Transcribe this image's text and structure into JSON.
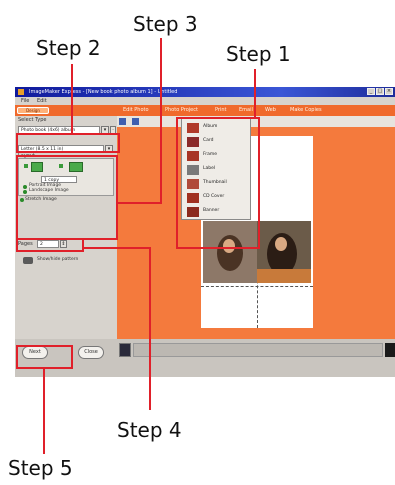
{
  "steps": {
    "step1": "Step 1",
    "step2": "Step 2",
    "step3": "Step 3",
    "step4": "Step 4",
    "step5": "Step 5"
  },
  "app": {
    "title": "ImageMaker Express - [New book photo album 1] - Untitled",
    "menu": [
      "File",
      "Edit"
    ],
    "toolbar_button": "Design",
    "toolbar_items": [
      "Edit Photo",
      "Photo Project",
      "Print",
      "Email",
      "Web",
      "Make Copies"
    ]
  },
  "left_panel": {
    "select_label": "Select Type",
    "project_select": "Photo book (4x6) album",
    "paper_select": "Letter (8.5 x 11 in)",
    "layout_label": "Layout",
    "copies_value": "1 copy",
    "options": [
      "Portrait Image",
      "Landscape Image",
      "Stretch Image"
    ],
    "pages_label": "Pages",
    "pages_value": "2",
    "canvas_option": "Show/hide pattern"
  },
  "insert_menu": {
    "items": [
      "Album",
      "Card",
      "Frame",
      "Label",
      "Thumbnail",
      "CD Cover",
      "Banner"
    ]
  },
  "buttons": {
    "next": "Next",
    "close": "Close"
  },
  "colors": {
    "accent": "#e0202a",
    "canvas": "#f47a3d",
    "titlebar": "#101a9c"
  }
}
